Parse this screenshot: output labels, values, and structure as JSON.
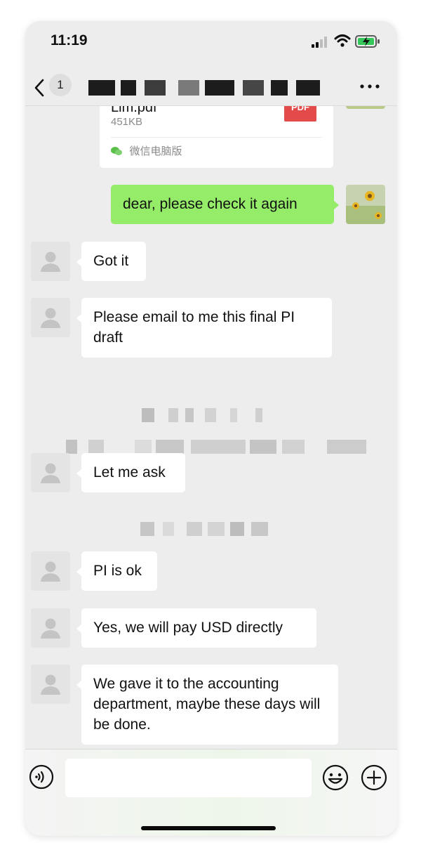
{
  "status_bar": {
    "time": "11:19"
  },
  "nav": {
    "unread_count": "1"
  },
  "file_message": {
    "file_name": "Lim.pdf",
    "file_size": "451KB",
    "file_type_label": "PDF",
    "source_label": "微信电脑版",
    "pdf_color": "#e34a4a"
  },
  "messages": [
    {
      "direction": "out",
      "text": "dear, please check it again"
    },
    {
      "direction": "in",
      "text": "Got it"
    },
    {
      "direction": "in",
      "text": "Please email to me this final PI draft"
    },
    {
      "direction": "in",
      "text": "Let me ask"
    },
    {
      "direction": "in",
      "text": "PI is ok"
    },
    {
      "direction": "in",
      "text": "Yes, we will pay USD directly"
    },
    {
      "direction": "in",
      "text": "We gave it to the accounting department, maybe these days will be done."
    }
  ],
  "colors": {
    "background": "#ededed",
    "outgoing_bubble": "#95ec69",
    "incoming_bubble": "#ffffff"
  },
  "icons": {
    "back": "chevron-left-icon",
    "more": "ellipsis-icon",
    "voice": "voice-icon",
    "emoji": "emoji-icon",
    "add": "plus-icon"
  }
}
